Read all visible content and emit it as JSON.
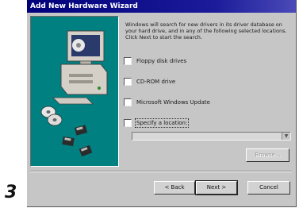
{
  "page_number": "3",
  "window": {
    "title": "Add New Hardware Wizard"
  },
  "instructions": "Windows will search for new drivers in its driver database on your hard drive, and in any of the following selected locations. Click Next to start the search.",
  "options": [
    {
      "label": "Floppy disk drives",
      "checked": false
    },
    {
      "label": "CD-ROM drive",
      "checked": false
    },
    {
      "label": "Microsoft Windows Update",
      "checked": false
    },
    {
      "label": "Specify a location:",
      "checked": false
    }
  ],
  "location": {
    "value": ""
  },
  "browse_label": "Browse...",
  "buttons": {
    "back": "< Back",
    "next": "Next >",
    "cancel": "Cancel"
  },
  "colors": {
    "titlebar": "#00007b",
    "dialog_face": "#c6c6c6",
    "illustration_bg": "#008080"
  }
}
